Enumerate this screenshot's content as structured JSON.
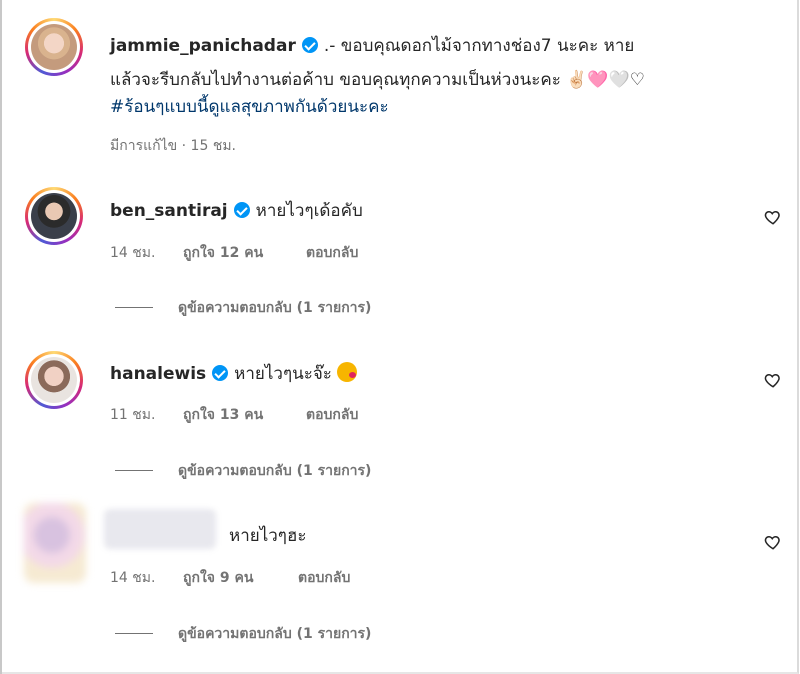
{
  "post": {
    "username": "jammie_panichadar",
    "caption_line1": ".- ขอบคุณดอกไม้จากทางช่อง7 นะคะ หาย",
    "caption_line2": "แล้วจะรีบกลับไปทำงานต่อค้าบ ขอบคุณทุกความเป็นห่วงนะคะ ✌🏻🩷🤍♡",
    "hashtag": "#ร้อนๆแบบนี้ดูแลสุขภาพกันด้วยนะคะ",
    "meta": "มีการแก้ไข · 15 ชม."
  },
  "comments": [
    {
      "username": "ben_santiraj",
      "text": "หายไวๆเด้อคับ",
      "time": "14 ชม.",
      "likes": "ถูกใจ 12 คน",
      "reply": "ตอบกลับ",
      "view_replies": "ดูข้อความตอบกลับ (1 รายการ)"
    },
    {
      "username": "hanalewis",
      "text": "หายไวๆนะจ๊ะ",
      "emoji": "😘",
      "time": "11 ชม.",
      "likes": "ถูกใจ 13 คน",
      "reply": "ตอบกลับ",
      "view_replies": "ดูข้อความตอบกลับ (1 รายการ)"
    },
    {
      "username": "",
      "text": "หายไวๆฮะ",
      "time": "14 ชม.",
      "likes": "ถูกใจ 9 คน",
      "reply": "ตอบกลับ",
      "view_replies": "ดูข้อความตอบกลับ (1 รายการ)"
    }
  ],
  "icons": {
    "verified": "verified-badge-icon",
    "like": "heart-outline-icon"
  },
  "colors": {
    "verified": "#0095f6",
    "hashtag": "#00376b",
    "meta": "#737373"
  }
}
